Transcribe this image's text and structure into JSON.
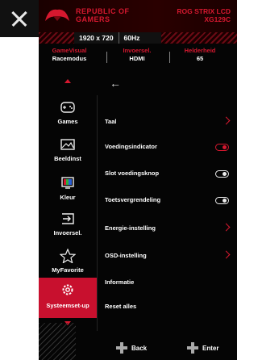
{
  "header": {
    "brand_line1": "REPUBLIC OF",
    "brand_line2": "GAMERS",
    "model_line1": "ROG STRIX LCD",
    "model_line2": "XG129C"
  },
  "resolution": {
    "res": "1920 x 720",
    "hz": "60Hz"
  },
  "status": [
    {
      "key": "GameVisual",
      "value": "Racemodus"
    },
    {
      "key": "Invoersel.",
      "value": "HDMI"
    },
    {
      "key": "Helderheid",
      "value": "65"
    }
  ],
  "sidebar": {
    "items": [
      {
        "label": "Games",
        "icon": "gamepad-icon"
      },
      {
        "label": "Beeldinst",
        "icon": "image-icon"
      },
      {
        "label": "Kleur",
        "icon": "color-icon"
      },
      {
        "label": "Invoersel.",
        "icon": "input-icon"
      },
      {
        "label": "MyFavorite",
        "icon": "star-icon"
      },
      {
        "label": "Systeemset-up",
        "icon": "settings-icon"
      }
    ]
  },
  "menu": {
    "items": [
      {
        "label": "Taal",
        "control": "chevron"
      },
      {
        "label": "Voedingsindicator",
        "control": "toggle-red"
      },
      {
        "label": "Slot voedingsknop",
        "control": "toggle"
      },
      {
        "label": "Toetsvergrendeling",
        "control": "toggle"
      },
      {
        "label": "Energie-instelling",
        "control": "chevron"
      },
      {
        "label": "OSD-instelling",
        "control": "chevron"
      },
      {
        "label": "Informatie",
        "control": "none"
      },
      {
        "label": "Reset alles",
        "control": "none"
      }
    ]
  },
  "footer": {
    "back": "Back",
    "enter": "Enter"
  },
  "colors": {
    "accent": "#d6182f",
    "active_bg": "#c8102e"
  }
}
